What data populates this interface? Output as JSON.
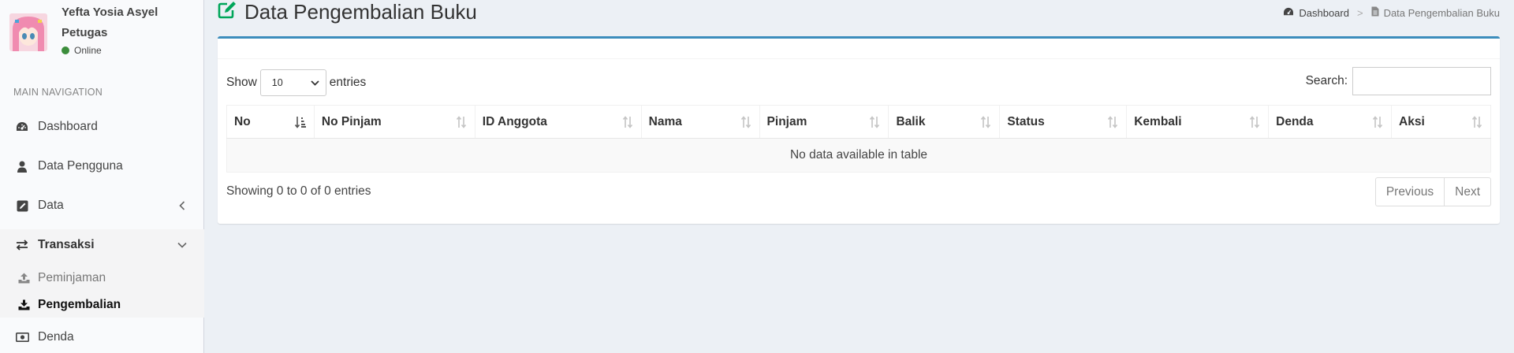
{
  "colors": {
    "accent": "#3c8dbc",
    "title_icon": "#00a65a",
    "status_online": "#3c8d3c",
    "page_bg": "#ecf0f5",
    "sidebar_bg": "#f9fafc"
  },
  "user": {
    "name": "Yefta Yosia Asyel Petugas",
    "status": "Online"
  },
  "sidebar": {
    "header": "MAIN NAVIGATION",
    "items": [
      {
        "label": "Dashboard",
        "icon": "dashboard-icon"
      },
      {
        "label": "Data Pengguna",
        "icon": "user-icon"
      },
      {
        "label": "Data",
        "icon": "edit-square-icon",
        "caret": "chevron-left-icon"
      },
      {
        "label": "Transaksi",
        "icon": "exchange-icon",
        "caret": "chevron-down-icon",
        "expanded": true
      },
      {
        "label": "Denda",
        "icon": "money-icon"
      }
    ],
    "transaksi_sub": [
      {
        "label": "Peminjaman",
        "icon": "upload-icon"
      },
      {
        "label": "Pengembalian",
        "icon": "download-icon",
        "current": true
      }
    ]
  },
  "header": {
    "title": "Data Pengembalian Buku",
    "title_icon": "edit-icon",
    "breadcrumb": [
      {
        "label": "Dashboard",
        "icon": "dashboard-icon"
      },
      {
        "label": "Data Pengembalian Buku",
        "icon": "file-icon"
      }
    ],
    "breadcrumb_sep": ">"
  },
  "table_controls": {
    "show_label": "Show",
    "entries_label": "entries",
    "page_length": "10",
    "search_label": "Search:",
    "search_value": ""
  },
  "table": {
    "columns": [
      "No",
      "No Pinjam",
      "ID Anggota",
      "Nama",
      "Pinjam",
      "Balik",
      "Status",
      "Kembali",
      "Denda",
      "Aksi"
    ],
    "sorted_column": "No",
    "empty_message": "No data available in table"
  },
  "footer": {
    "info": "Showing 0 to 0 of 0 entries",
    "previous": "Previous",
    "next": "Next"
  }
}
